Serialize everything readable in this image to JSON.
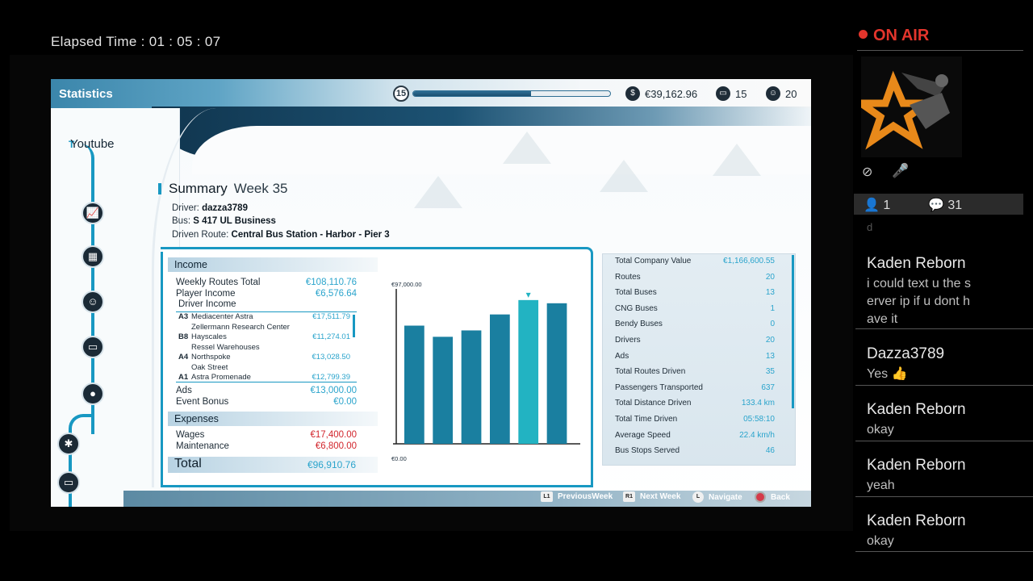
{
  "stream": {
    "elapsed_label": "Elapsed Time :",
    "elapsed_value": "01 : 05 : 07",
    "on_air": "ON AIR",
    "viewers": "1",
    "comments": "31",
    "faded_message": "d"
  },
  "chat": [
    {
      "user": "Kaden Reborn",
      "message": "i could text u the s\nerver ip if u dont h\nave it"
    },
    {
      "user": "Dazza3789",
      "message": "Yes 👍"
    },
    {
      "user": "Kaden Reborn",
      "message": "okay"
    },
    {
      "user": "Kaden Reborn",
      "message": "yeah"
    },
    {
      "user": "Kaden Reborn",
      "message": "okay"
    }
  ],
  "game": {
    "screen_title": "Statistics",
    "level": "15",
    "xp_fraction": 0.6,
    "money": "€39,162.96",
    "buses": "15",
    "drivers": "20",
    "company": "Youtube",
    "summary_title": "Summary",
    "week": "Week 35",
    "driver_label": "Driver:",
    "driver_value": "dazza3789",
    "bus_label": "Bus:",
    "bus_value": "S 417 UL Business",
    "route_label": "Driven Route:",
    "route_value": "Central Bus Station - Harbor - Pier 3",
    "income": {
      "title": "Income",
      "weekly_routes_label": "Weekly Routes Total",
      "weekly_routes_value": "€108,110.76",
      "player_income_label": "Player Income",
      "player_income_value": "€6,576.64",
      "driver_income_label": "Driver Income",
      "ads_label": "Ads",
      "ads_value": "€13,000.00",
      "event_label": "Event Bonus",
      "event_value": "€0.00"
    },
    "driver_rows": [
      {
        "code": "A3",
        "name": "Mediacenter Astra",
        "value": "€17,511.79"
      },
      {
        "code": "",
        "name": "Zellermann Research Center",
        "value": ""
      },
      {
        "code": "B8",
        "name": "Hayscales",
        "value": "€11,274.01"
      },
      {
        "code": "",
        "name": "Ressel Warehouses",
        "value": ""
      },
      {
        "code": "A4",
        "name": "Northspoke",
        "value": "€13,028.50"
      },
      {
        "code": "",
        "name": "Oak Street",
        "value": ""
      },
      {
        "code": "A1",
        "name": "Astra Promenade",
        "value": "€12,799.39"
      }
    ],
    "expenses": {
      "title": "Expenses",
      "wages_label": "Wages",
      "wages_value": "€17,400.00",
      "maintenance_label": "Maintenance",
      "maintenance_value": "€6,800.00"
    },
    "total_label": "Total",
    "total_value": "€96,910.76",
    "stats": [
      {
        "label": "Total Company Value",
        "value": "€1,166,600.55"
      },
      {
        "label": "Routes",
        "value": "20"
      },
      {
        "label": "Total Buses",
        "value": "13"
      },
      {
        "label": "CNG Buses",
        "value": "1"
      },
      {
        "label": "Bendy Buses",
        "value": "0"
      },
      {
        "label": "Drivers",
        "value": "20"
      },
      {
        "label": "Ads",
        "value": "13"
      },
      {
        "label": "Total Routes Driven",
        "value": "35"
      },
      {
        "label": "Passengers Transported",
        "value": "637"
      },
      {
        "label": "Total Distance Driven",
        "value": "133.4 km"
      },
      {
        "label": "Total Time Driven",
        "value": "05:58:10"
      },
      {
        "label": "Average Speed",
        "value": "22.4 km/h"
      },
      {
        "label": "Bus Stops Served",
        "value": "46"
      }
    ],
    "hints": {
      "prev_btn": "L1",
      "prev": "PreviousWeek",
      "next_btn": "R1",
      "next": "Next Week",
      "nav_btn": "L",
      "nav": "Navigate",
      "back": "Back"
    }
  },
  "chart_data": {
    "type": "bar",
    "title": "",
    "xlabel": "",
    "ylabel": "",
    "ymax_label": "€97,000.00",
    "ymin_label": "€0.00",
    "ylim": [
      0,
      97000
    ],
    "values": [
      74000,
      67000,
      71000,
      81000,
      90000,
      88000
    ],
    "highlight_index": 4,
    "colors": {
      "bar": "#1a7fa0",
      "highlight": "#22b3c2",
      "axis": "#222222"
    }
  }
}
